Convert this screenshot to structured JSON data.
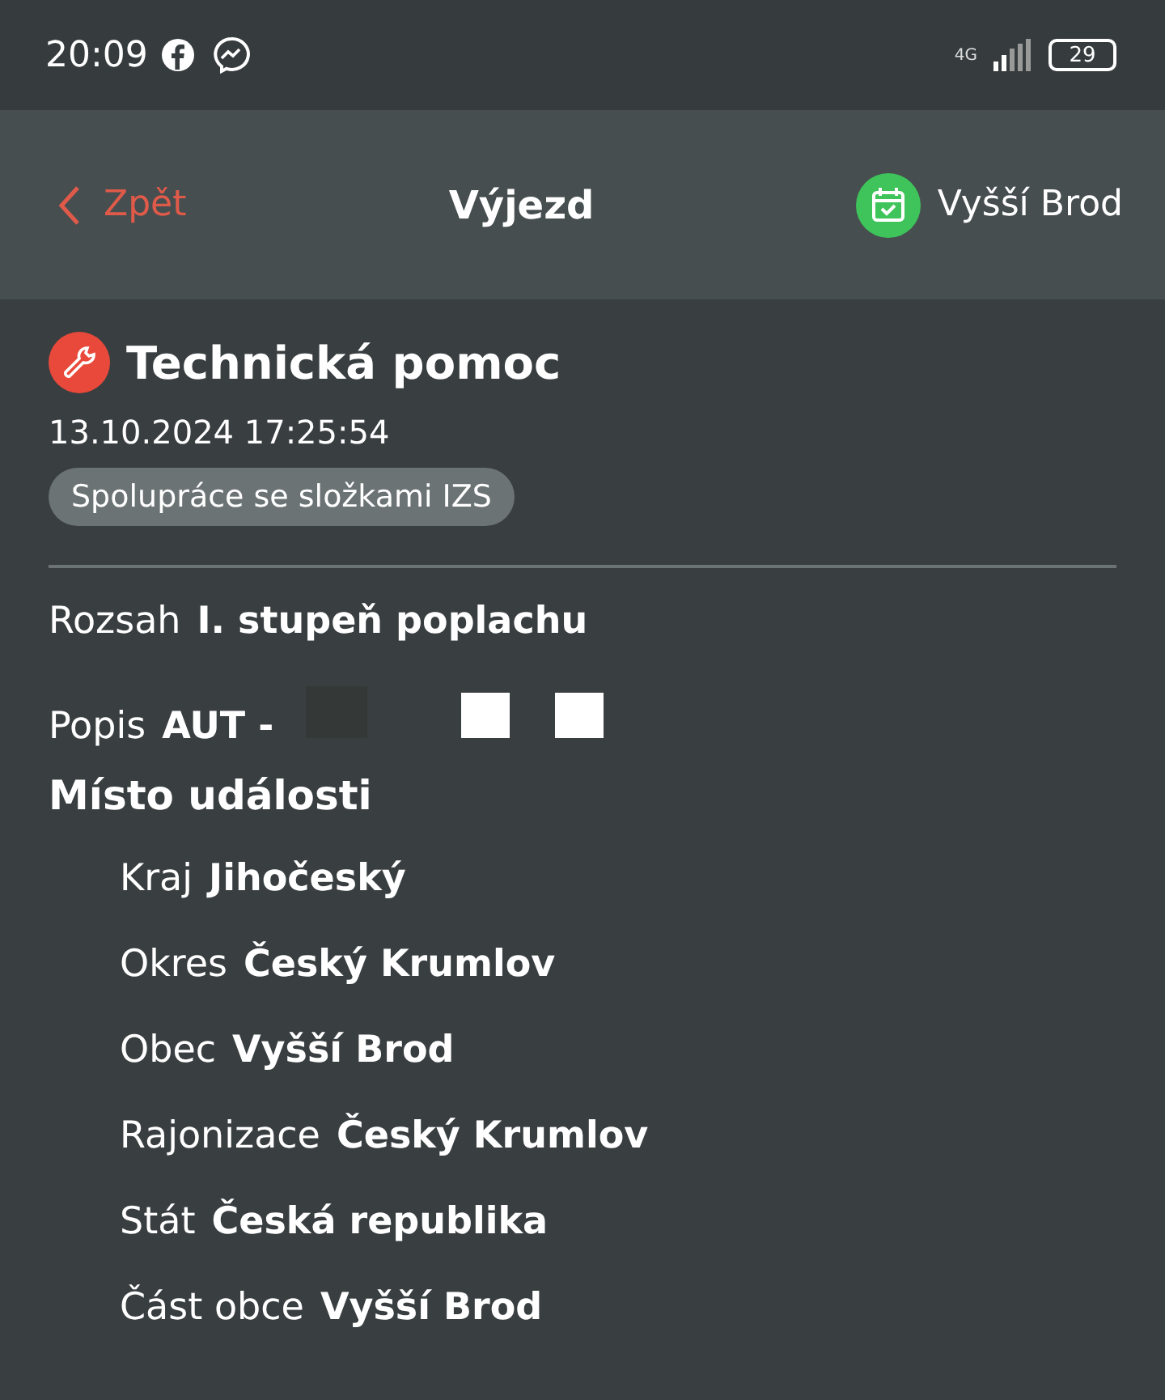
{
  "status_bar": {
    "time": "20:09",
    "network": "4G",
    "battery": "29"
  },
  "header": {
    "back": "Zpět",
    "title": "Výjezd",
    "station": "Vyšší Brod"
  },
  "event": {
    "title": "Technická pomoc",
    "datetime": "13.10.2024 17:25:54",
    "tag": "Spolupráce se složkami IZS"
  },
  "fields": [
    {
      "label": "Rozsah",
      "value": "I. stupeň poplachu"
    },
    {
      "label": "Popis",
      "value": "AUT -",
      "redacted": true
    }
  ],
  "location": {
    "title": "Místo události",
    "fields": [
      {
        "label": "Kraj",
        "value": "Jihočeský"
      },
      {
        "label": "Okres",
        "value": "Český Krumlov"
      },
      {
        "label": "Obec",
        "value": "Vyšší Brod"
      },
      {
        "label": "Rajonizace",
        "value": "Český Krumlov"
      },
      {
        "label": "Stát",
        "value": "Česká republika"
      },
      {
        "label": "Část obce",
        "value": "Vyšší Brod"
      }
    ]
  }
}
